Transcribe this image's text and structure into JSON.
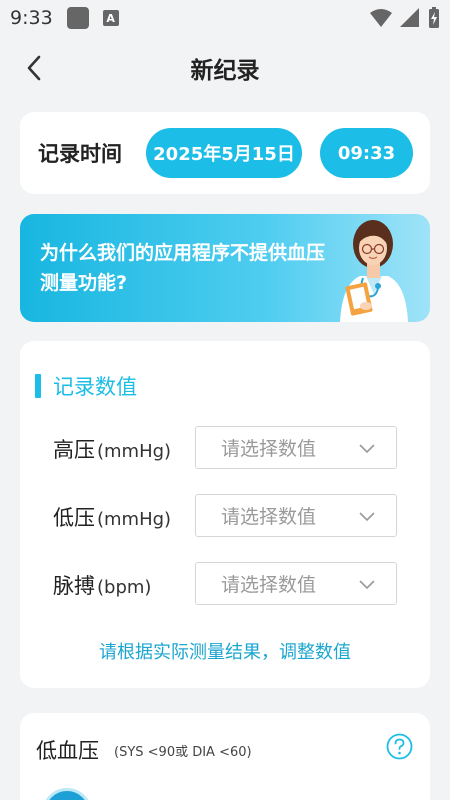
{
  "status_bar": {
    "time": "9:33",
    "a_icon_letter": "A"
  },
  "header": {
    "title": "新纪录"
  },
  "record_time": {
    "label": "记录时间",
    "date": "2025年5月15日",
    "time": "09:33"
  },
  "banner": {
    "text": "为什么我们的应用程序不提供血压测量功能?"
  },
  "record_values": {
    "title": "记录数值",
    "fields": [
      {
        "label": "高压",
        "unit": "(mmHg)",
        "placeholder": "请选择数值"
      },
      {
        "label": "低压",
        "unit": "(mmHg)",
        "placeholder": "请选择数值"
      },
      {
        "label": "脉搏",
        "unit": "(bpm)",
        "placeholder": "请选择数值"
      }
    ],
    "hint": "请根据实际测量结果，调整数值"
  },
  "category": {
    "title": "低血压",
    "criteria": "(SYS <90或 DIA <60)"
  },
  "colors": {
    "accent": "#1cbde6",
    "background": "#f2f3f5"
  }
}
